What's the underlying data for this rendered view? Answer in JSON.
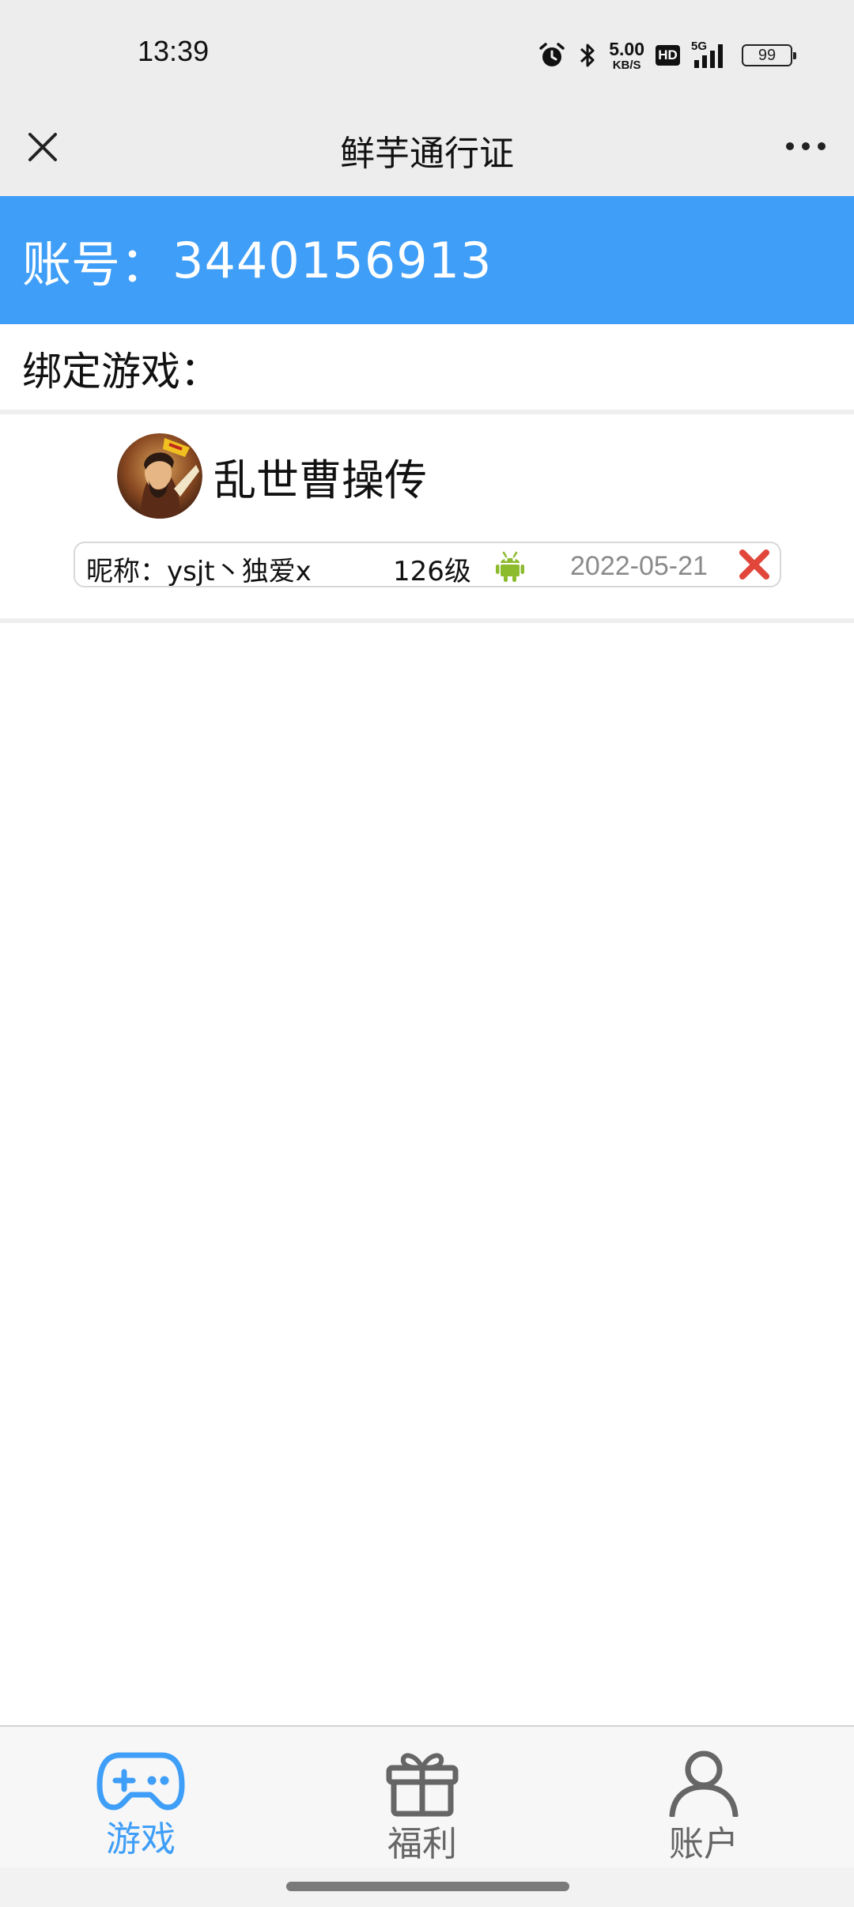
{
  "status_bar": {
    "time": "13:39",
    "net_speed_value": "5.00",
    "net_speed_unit": "KB/S",
    "hd_label": "HD",
    "network_label": "5G",
    "battery_level": "99",
    "icons": [
      "alarm-icon",
      "bluetooth-icon",
      "hd-icon",
      "signal-icon",
      "battery-icon"
    ]
  },
  "title_bar": {
    "title": "鲜芋通行证",
    "close_icon": "close-icon",
    "more_icon": "more-icon"
  },
  "account": {
    "label": "账号：",
    "number": "3440156913"
  },
  "bind_section": {
    "title": "绑定游戏："
  },
  "games": [
    {
      "name": "乱世曹操传",
      "avatar_icon": "game-avatar",
      "nickname_label": "昵称：",
      "nickname": "ysjt丶独爱x",
      "level": "126级",
      "platform_icon": "android-icon",
      "bind_date": "2022-05-21",
      "delete_icon": "delete-icon"
    }
  ],
  "bottom_nav": {
    "items": [
      {
        "label": "游戏",
        "icon": "gamepad-icon",
        "active": true
      },
      {
        "label": "福利",
        "icon": "gift-icon",
        "active": false
      },
      {
        "label": "账户",
        "icon": "user-icon",
        "active": false
      }
    ]
  },
  "colors": {
    "accent": "#3f9ef7",
    "status_bar_bg": "#ededed",
    "android_green": "#8dbb2e",
    "delete_red": "#e2463b",
    "inactive_nav": "#666666"
  }
}
